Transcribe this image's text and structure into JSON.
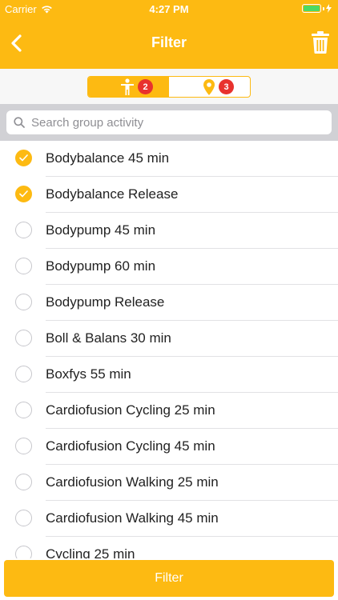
{
  "status": {
    "carrier": "Carrier",
    "time": "4:27 PM"
  },
  "nav": {
    "title": "Filter",
    "back_icon": "chevron-left-icon",
    "trash_icon": "trash-icon"
  },
  "segments": [
    {
      "icon": "person-icon",
      "badge": "2",
      "active": true
    },
    {
      "icon": "location-pin-icon",
      "badge": "3",
      "active": false
    }
  ],
  "search": {
    "placeholder": "Search group activity"
  },
  "activities": [
    {
      "label": "Bodybalance 45 min",
      "checked": true
    },
    {
      "label": "Bodybalance Release",
      "checked": true
    },
    {
      "label": "Bodypump 45 min",
      "checked": false
    },
    {
      "label": "Bodypump 60 min",
      "checked": false
    },
    {
      "label": "Bodypump Release",
      "checked": false
    },
    {
      "label": "Boll & Balans 30 min",
      "checked": false
    },
    {
      "label": "Boxfys 55 min",
      "checked": false
    },
    {
      "label": "Cardiofusion Cycling 25 min",
      "checked": false
    },
    {
      "label": "Cardiofusion Cycling 45 min",
      "checked": false
    },
    {
      "label": "Cardiofusion Walking 25 min",
      "checked": false
    },
    {
      "label": "Cardiofusion Walking 45 min",
      "checked": false
    },
    {
      "label": "Cycling 25 min",
      "checked": false
    }
  ],
  "footer": {
    "button_label": "Filter"
  },
  "colors": {
    "accent": "#FDBA12",
    "badge": "#E8322E"
  }
}
